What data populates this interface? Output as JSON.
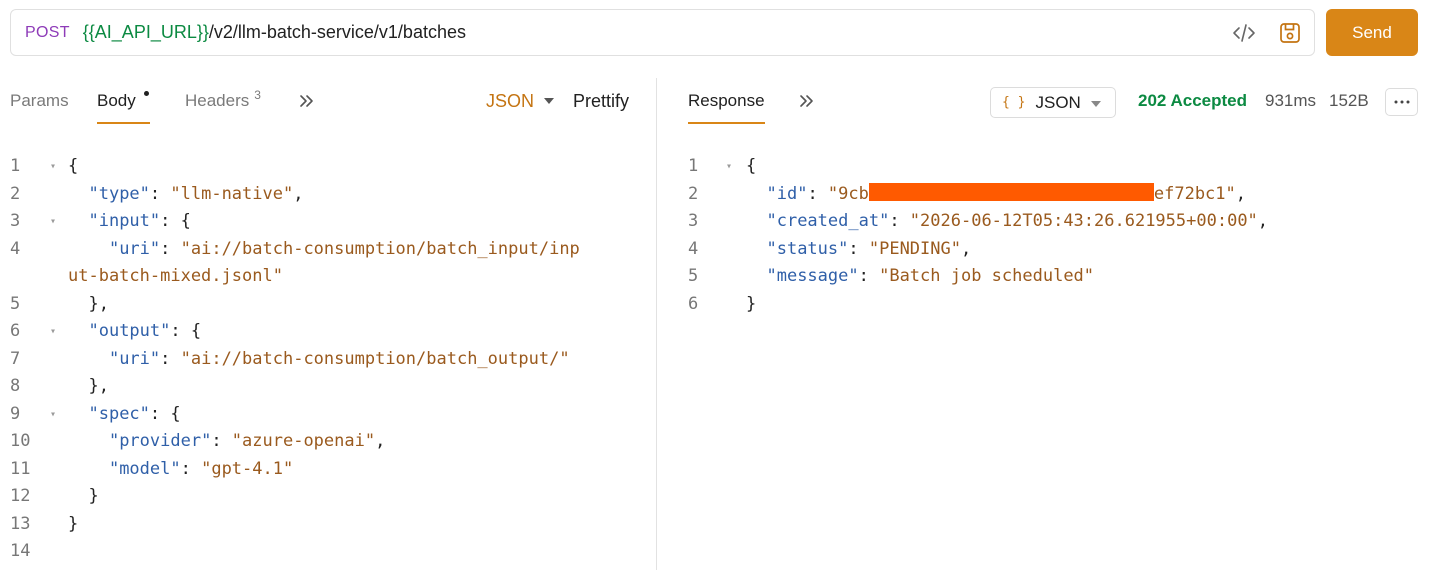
{
  "request": {
    "method": "POST",
    "url_variable": "{{AI_API_URL}}",
    "url_path": "/v2/llm-batch-service/v1/batches",
    "send_label": "Send"
  },
  "request_tabs": {
    "params": "Params",
    "body": "Body",
    "headers": "Headers",
    "headers_count": "3",
    "body_format": "JSON",
    "prettify": "Prettify"
  },
  "response_tabs": {
    "response": "Response",
    "format": "JSON",
    "status": "202 Accepted",
    "time": "931ms",
    "size": "152B"
  },
  "request_body_lines": [
    {
      "n": "1",
      "fold": true,
      "indent": 0,
      "parts": [
        [
          "p",
          "{"
        ]
      ]
    },
    {
      "n": "2",
      "fold": false,
      "indent": 1,
      "parts": [
        [
          "k",
          "\"type\""
        ],
        [
          "p",
          ": "
        ],
        [
          "s",
          "\"llm-native\""
        ],
        [
          "p",
          ","
        ]
      ]
    },
    {
      "n": "3",
      "fold": true,
      "indent": 1,
      "parts": [
        [
          "k",
          "\"input\""
        ],
        [
          "p",
          ": {"
        ]
      ]
    },
    {
      "n": "4",
      "fold": false,
      "indent": 2,
      "parts": [
        [
          "k",
          "\"uri\""
        ],
        [
          "p",
          ": "
        ],
        [
          "s",
          "\"ai://batch-consumption/batch_input/inp"
        ]
      ]
    },
    {
      "n": "",
      "fold": false,
      "indent": 0,
      "parts": [
        [
          "s",
          "ut-batch-mixed.jsonl\""
        ]
      ]
    },
    {
      "n": "5",
      "fold": false,
      "indent": 1,
      "parts": [
        [
          "p",
          "},"
        ]
      ]
    },
    {
      "n": "6",
      "fold": true,
      "indent": 1,
      "parts": [
        [
          "k",
          "\"output\""
        ],
        [
          "p",
          ": {"
        ]
      ]
    },
    {
      "n": "7",
      "fold": false,
      "indent": 2,
      "parts": [
        [
          "k",
          "\"uri\""
        ],
        [
          "p",
          ": "
        ],
        [
          "s",
          "\"ai://batch-consumption/batch_output/\""
        ]
      ]
    },
    {
      "n": "8",
      "fold": false,
      "indent": 1,
      "parts": [
        [
          "p",
          "},"
        ]
      ]
    },
    {
      "n": "9",
      "fold": true,
      "indent": 1,
      "parts": [
        [
          "k",
          "\"spec\""
        ],
        [
          "p",
          ": {"
        ]
      ]
    },
    {
      "n": "10",
      "fold": false,
      "indent": 2,
      "parts": [
        [
          "k",
          "\"provider\""
        ],
        [
          "p",
          ": "
        ],
        [
          "s",
          "\"azure-openai\""
        ],
        [
          "p",
          ","
        ]
      ]
    },
    {
      "n": "11",
      "fold": false,
      "indent": 2,
      "parts": [
        [
          "k",
          "\"model\""
        ],
        [
          "p",
          ": "
        ],
        [
          "s",
          "\"gpt-4.1\""
        ]
      ]
    },
    {
      "n": "12",
      "fold": false,
      "indent": 1,
      "parts": [
        [
          "p",
          "}"
        ]
      ]
    },
    {
      "n": "13",
      "fold": false,
      "indent": 0,
      "parts": [
        [
          "p",
          "}"
        ]
      ]
    },
    {
      "n": "14",
      "fold": false,
      "indent": 0,
      "parts": []
    }
  ],
  "response_body_lines": [
    {
      "n": "1",
      "fold": true,
      "indent": 0,
      "parts": [
        [
          "p",
          "{"
        ]
      ]
    },
    {
      "n": "2",
      "fold": false,
      "indent": 1,
      "parts": [
        [
          "k",
          "\"id\""
        ],
        [
          "p",
          ": "
        ],
        [
          "s",
          "\"9cb"
        ],
        [
          "r",
          ""
        ],
        [
          "s",
          "ef72bc1\""
        ],
        [
          "p",
          ","
        ]
      ]
    },
    {
      "n": "3",
      "fold": false,
      "indent": 1,
      "parts": [
        [
          "k",
          "\"created_at\""
        ],
        [
          "p",
          ": "
        ],
        [
          "s",
          "\"2026-06-12T05:43:26.621955+00:00\""
        ],
        [
          "p",
          ","
        ]
      ]
    },
    {
      "n": "4",
      "fold": false,
      "indent": 1,
      "parts": [
        [
          "k",
          "\"status\""
        ],
        [
          "p",
          ": "
        ],
        [
          "s",
          "\"PENDING\""
        ],
        [
          "p",
          ","
        ]
      ]
    },
    {
      "n": "5",
      "fold": false,
      "indent": 1,
      "parts": [
        [
          "k",
          "\"message\""
        ],
        [
          "p",
          ": "
        ],
        [
          "s",
          "\"Batch job scheduled\""
        ]
      ]
    },
    {
      "n": "6",
      "fold": false,
      "indent": 0,
      "parts": [
        [
          "p",
          "}"
        ]
      ]
    }
  ],
  "colors": {
    "accent": "#d98617",
    "method": "#8e3bb8",
    "variable": "#0c8a42",
    "status_ok": "#0c8a42",
    "json_key": "#2f5fa8",
    "json_string": "#9a5a1e",
    "redaction": "#ff5a00"
  },
  "icons": {
    "code_snippet": "code-icon",
    "save": "save-icon",
    "more": "more-horizontal-icon",
    "overflow": "chevron-double-right-icon",
    "dropdown": "caret-down-icon",
    "fold": "fold-arrow-icon"
  }
}
